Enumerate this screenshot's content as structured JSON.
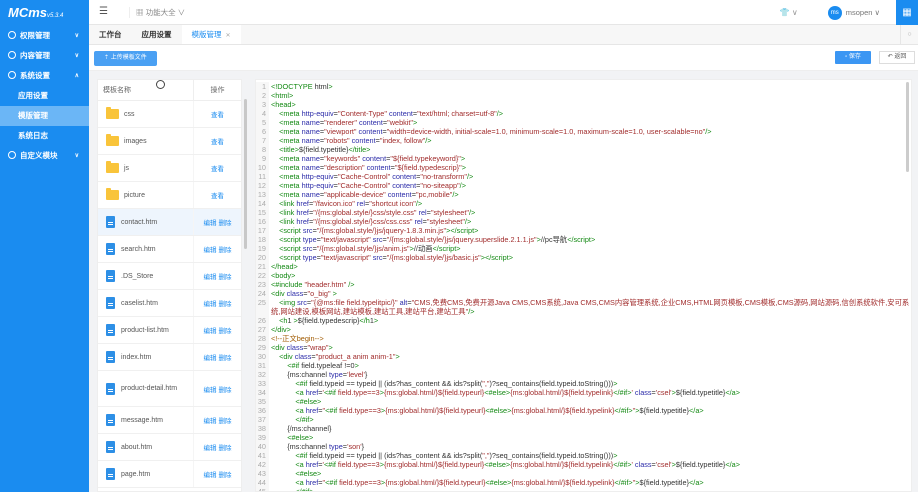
{
  "app": {
    "logo": "MCms",
    "version": "v5.3.4"
  },
  "sidebar": {
    "menus": [
      {
        "label": "权限管理",
        "icon": "shield-icon",
        "chevron": "∨"
      },
      {
        "label": "内容管理",
        "icon": "layers-icon",
        "chevron": "∨"
      },
      {
        "label": "系统设置",
        "icon": "gear-icon",
        "chevron": "∧",
        "children": [
          "应用设置",
          "模版管理",
          "系统日志"
        ]
      },
      {
        "label": "自定义模块",
        "icon": "module-icon",
        "chevron": "∨"
      }
    ],
    "active": "模版管理"
  },
  "header": {
    "menu_icon": "☰",
    "func_label": "功能大全",
    "user": "msopen",
    "avatar_text": "ms"
  },
  "tabs": [
    {
      "label": "工作台"
    },
    {
      "label": "应用设置"
    },
    {
      "label": "模版管理",
      "closable": true
    }
  ],
  "toolbar": {
    "upload_label": "上传模板文件",
    "save_label": "保存",
    "back_label": "返回"
  },
  "filetable": {
    "headers": [
      "模板名称",
      "操作"
    ],
    "rows": [
      {
        "name": "css",
        "type": "folder",
        "actions": [
          "查看"
        ]
      },
      {
        "name": "images",
        "type": "folder",
        "actions": [
          "查看"
        ]
      },
      {
        "name": "js",
        "type": "folder",
        "actions": [
          "查看"
        ]
      },
      {
        "name": "picture",
        "type": "folder",
        "actions": [
          "查看"
        ]
      },
      {
        "name": "contact.htm",
        "type": "file",
        "actions": [
          "编辑",
          "删除"
        ]
      },
      {
        "name": "search.htm",
        "type": "file",
        "actions": [
          "编辑",
          "删除"
        ]
      },
      {
        "name": ".DS_Store",
        "type": "file",
        "actions": [
          "编辑",
          "删除"
        ]
      },
      {
        "name": "caselist.htm",
        "type": "file",
        "actions": [
          "编辑",
          "删除"
        ]
      },
      {
        "name": "product-list.htm",
        "type": "file",
        "actions": [
          "编辑",
          "删除"
        ]
      },
      {
        "name": "index.htm",
        "type": "file",
        "actions": [
          "编辑",
          "删除"
        ]
      },
      {
        "name": "product-detail.htm",
        "type": "file",
        "actions": [
          "编辑",
          "删除"
        ]
      },
      {
        "name": "message.htm",
        "type": "file",
        "actions": [
          "编辑",
          "删除"
        ]
      },
      {
        "name": "about.htm",
        "type": "file",
        "actions": [
          "编辑",
          "删除"
        ]
      },
      {
        "name": "page.htm",
        "type": "file",
        "actions": [
          "编辑",
          "删除"
        ]
      }
    ]
  },
  "editor": {
    "lines": [
      "<!DOCTYPE html>",
      "<html>",
      "<head>",
      "    <meta http-equiv=\"Content-Type\" content=\"text/html; charset=utf-8\"/>",
      "    <meta name=\"renderer\" content=\"webkit\">",
      "    <meta name=\"viewport\" content=\"width=device-width, initial-scale=1.0, minimum-scale=1.0, maximum-scale=1.0, user-scalable=no\"/>",
      "    <meta name=\"robots\" content=\"index, follow\"/>",
      "    <title>${field.typetitle}</title>",
      "    <meta name=\"keywords\" content=\"${field.typekeyword}\">",
      "    <meta name=\"description\" content=\"${field.typedescrip}\">",
      "    <meta http-equiv=\"Cache-Control\" content=\"no-transform\"/>",
      "    <meta http-equiv=\"Cache-Control\" content=\"no-siteapp\"/>",
      "    <meta name=\"applicable-device\" content=\"pc,mobile\"/>",
      "    <link href=\"/favicon.ico\" rel=\"shortcut icon\"/>",
      "    <link href=\"/{ms:global.style/}css/style.css\" rel=\"stylesheet\"/>",
      "    <link href=\"/{ms:global.style/}css/css.css\" rel=\"stylesheet\"/>",
      "    <script src=\"/{ms:global.style/}js/jquery-1.8.3.min.js\"></script>",
      "    <script type=\"text/javascript\" src=\"/{ms:global.style/}js/jquery.superslide.2.1.1.js\">//pc导航</script>",
      "    <script src=\"/{ms:global.style/}js/anim.js\">//动画</script>",
      "    <script type=\"text/javascript\" src=\"/{ms:global.style/}js/basic.js\"></script>",
      "</head>",
      "<body>",
      "<#include \"header.htm\" />",
      "<div class=\"o_big\" >",
      "    <img src=\"{@ms:file field.typelitpic/}\" alt=\"CMS,免费CMS,免费开源Java CMS,CMS系统,Java CMS,CMS内容管理系统,企业CMS,HTML网页模板,CMS模板,CMS源码,网站源码,信创系统软件,安可系统,网站建设,模板网站,建站模板,建站工具,建站平台,建站工具\"/>",
      "    <h1 >${field.typedescrip}</h1>",
      "</div>",
      "<!--正文begin-->",
      "<div class=\"wrap\">",
      "    <div class=\"product_a anim anim-1\">",
      "        <#if field.typeleaf !=0>",
      "        {ms:channel type='level'}",
      "            <#if field.typeid == typeid || (ids?has_content && ids?split(\",\")?seq_contains(field.typeid.toString()))>",
      "            <a href='<#if field.type==3>{ms:global.html/}${field.typeurl}<#else>{ms:global.html/}${field.typelink}</#if>' class='csel'>${field.typetitle}</a>",
      "            <#else>",
      "            <a href=\"<#if field.type==3>{ms:global.html/}${field.typeurl}<#else>{ms:global.html/}${field.typelink}</#if>\">${field.typetitle}</a>",
      "            </#if>",
      "        {/ms:channel}",
      "        <#else>",
      "        {ms:channel type='son'}",
      "            <#if field.typeid == typeid || (ids?has_content && ids?split(\",\")?seq_contains(field.typeid.toString()))>",
      "            <a href='<#if field.type==3>{ms:global.html/}${field.typeurl}<#else>{ms:global.html/}${field.typelink}</#if>' class='csel'>${field.typetitle}</a>",
      "            <#else>",
      "            <a href=\"<#if field.type==3>{ms:global.html/}${field.typeurl}<#else>{ms:global.html/}${field.typelink}</#if>\">${field.typetitle}</a>",
      "            </#if>"
    ]
  },
  "colors": {
    "accent": "#1a8cf0",
    "tag": "#118811",
    "attr": "#2a2aa8",
    "string": "#a12c2c"
  }
}
